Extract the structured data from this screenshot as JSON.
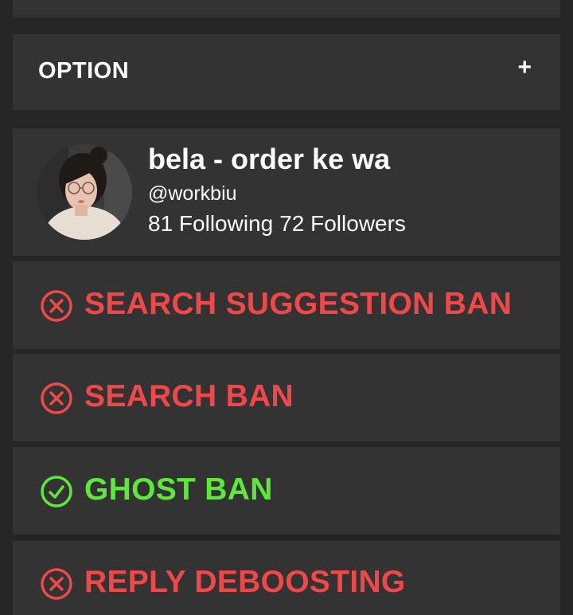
{
  "option": {
    "label": "OPTION",
    "toggle_glyph": "+"
  },
  "profile": {
    "display_name": "bela - order ke wa",
    "handle": "@workbiu",
    "following": "81 Following",
    "followers": "72 Followers"
  },
  "colors": {
    "background": "#262626",
    "card": "#333333",
    "banned": "#f04848",
    "ok": "#5ee83a",
    "text": "#ffffff"
  },
  "checks": [
    {
      "label": "SEARCH SUGGESTION BAN",
      "status": "banned",
      "icon": "x-circle-icon"
    },
    {
      "label": "SEARCH BAN",
      "status": "banned",
      "icon": "x-circle-icon"
    },
    {
      "label": "GHOST BAN",
      "status": "ok",
      "icon": "check-circle-icon"
    },
    {
      "label": "REPLY DEBOOSTING",
      "status": "banned",
      "icon": "x-circle-icon"
    }
  ]
}
